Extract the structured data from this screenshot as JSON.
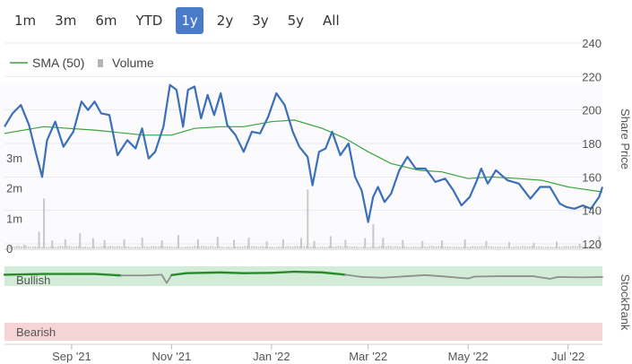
{
  "range_selector": {
    "buttons": [
      "1m",
      "3m",
      "6m",
      "YTD",
      "1y",
      "2y",
      "3y",
      "5y",
      "All"
    ],
    "active": "1y"
  },
  "legend": {
    "sma_label": "SMA (50)",
    "volume_label": "Volume"
  },
  "axes": {
    "price_title": "Share Price",
    "rank_title": "StockRank",
    "price_ticks": [
      "240",
      "220",
      "200",
      "180",
      "160",
      "140",
      "120"
    ],
    "volume_ticks": [
      "3m",
      "2m",
      "1m",
      "0"
    ],
    "date_ticks": [
      "Sep '21",
      "Nov '21",
      "Jan '22",
      "Mar '22",
      "May '22",
      "Jul '22"
    ]
  },
  "rank_bands": {
    "top": "Bullish",
    "bottom": "Bearish"
  },
  "colors": {
    "price": "#3b6fba",
    "sma": "#3aa33a",
    "volume": "#c8c8c8",
    "rank_bull": "#2a8a2a",
    "rank_neutral": "#8f8f8f",
    "bull_band": "#d3ecd8",
    "bear_band": "#f6d3d5"
  },
  "chart_data": {
    "type": "line",
    "x_range": [
      "2021-07-22",
      "2022-07-22"
    ],
    "ylim": [
      120,
      240
    ],
    "series": [
      {
        "name": "Share Price",
        "points": [
          [
            "2021-07-22",
            190
          ],
          [
            "2021-07-27",
            198
          ],
          [
            "2021-08-01",
            203
          ],
          [
            "2021-08-06",
            191
          ],
          [
            "2021-08-10",
            175
          ],
          [
            "2021-08-14",
            160
          ],
          [
            "2021-08-17",
            182
          ],
          [
            "2021-08-22",
            193
          ],
          [
            "2021-08-27",
            178
          ],
          [
            "2021-09-02",
            187
          ],
          [
            "2021-09-07",
            205
          ],
          [
            "2021-09-11",
            200
          ],
          [
            "2021-09-15",
            205
          ],
          [
            "2021-09-19",
            198
          ],
          [
            "2021-09-24",
            197
          ],
          [
            "2021-09-29",
            173
          ],
          [
            "2021-10-05",
            182
          ],
          [
            "2021-10-10",
            177
          ],
          [
            "2021-10-14",
            189
          ],
          [
            "2021-10-18",
            171
          ],
          [
            "2021-10-22",
            175
          ],
          [
            "2021-10-27",
            190
          ],
          [
            "2021-10-31",
            215
          ],
          [
            "2021-11-04",
            212
          ],
          [
            "2021-11-08",
            190
          ],
          [
            "2021-11-11",
            212
          ],
          [
            "2021-11-15",
            214
          ],
          [
            "2021-11-19",
            195
          ],
          [
            "2021-11-23",
            209
          ],
          [
            "2021-11-27",
            197
          ],
          [
            "2021-12-01",
            210
          ],
          [
            "2021-12-05",
            191
          ],
          [
            "2021-12-10",
            185
          ],
          [
            "2021-12-15",
            175
          ],
          [
            "2021-12-20",
            187
          ],
          [
            "2021-12-25",
            186
          ],
          [
            "2021-12-30",
            196
          ],
          [
            "2022-01-04",
            210
          ],
          [
            "2022-01-09",
            203
          ],
          [
            "2022-01-14",
            187
          ],
          [
            "2022-01-18",
            178
          ],
          [
            "2022-01-23",
            172
          ],
          [
            "2022-01-26",
            155
          ],
          [
            "2022-01-30",
            175
          ],
          [
            "2022-02-03",
            177
          ],
          [
            "2022-02-07",
            187
          ],
          [
            "2022-02-12",
            173
          ],
          [
            "2022-02-17",
            180
          ],
          [
            "2022-02-21",
            160
          ],
          [
            "2022-02-25",
            152
          ],
          [
            "2022-03-01",
            133
          ],
          [
            "2022-03-04",
            148
          ],
          [
            "2022-03-07",
            154
          ],
          [
            "2022-03-11",
            145
          ],
          [
            "2022-03-15",
            150
          ],
          [
            "2022-03-20",
            164
          ],
          [
            "2022-03-25",
            172
          ],
          [
            "2022-03-30",
            165
          ],
          [
            "2022-04-05",
            165
          ],
          [
            "2022-04-11",
            157
          ],
          [
            "2022-04-17",
            159
          ],
          [
            "2022-04-22",
            152
          ],
          [
            "2022-04-27",
            143
          ],
          [
            "2022-05-02",
            148
          ],
          [
            "2022-05-06",
            157
          ],
          [
            "2022-05-09",
            165
          ],
          [
            "2022-05-13",
            156
          ],
          [
            "2022-05-18",
            164
          ],
          [
            "2022-05-25",
            158
          ],
          [
            "2022-06-01",
            156
          ],
          [
            "2022-06-08",
            147
          ],
          [
            "2022-06-14",
            154
          ],
          [
            "2022-06-20",
            154
          ],
          [
            "2022-06-26",
            144
          ],
          [
            "2022-06-30",
            142
          ],
          [
            "2022-07-05",
            141
          ],
          [
            "2022-07-10",
            143
          ],
          [
            "2022-07-15",
            141
          ],
          [
            "2022-07-20",
            148
          ],
          [
            "2022-07-22",
            154
          ]
        ]
      },
      {
        "name": "SMA (50)",
        "points": [
          [
            "2021-07-22",
            186
          ],
          [
            "2021-08-15",
            190
          ],
          [
            "2021-09-15",
            188
          ],
          [
            "2021-10-15",
            185
          ],
          [
            "2021-11-01",
            185
          ],
          [
            "2021-11-15",
            189
          ],
          [
            "2021-12-01",
            190
          ],
          [
            "2021-12-15",
            190
          ],
          [
            "2022-01-01",
            193
          ],
          [
            "2022-01-15",
            194
          ],
          [
            "2022-02-01",
            189
          ],
          [
            "2022-02-15",
            183
          ],
          [
            "2022-03-01",
            175
          ],
          [
            "2022-03-15",
            168
          ],
          [
            "2022-04-01",
            164
          ],
          [
            "2022-04-15",
            163
          ],
          [
            "2022-05-01",
            159
          ],
          [
            "2022-05-15",
            160
          ],
          [
            "2022-06-01",
            159
          ],
          [
            "2022-06-15",
            158
          ],
          [
            "2022-07-01",
            154
          ],
          [
            "2022-07-22",
            151
          ]
        ]
      }
    ],
    "volume": {
      "ylim": [
        0,
        3000000
      ],
      "points": [
        [
          "2021-08-03",
          120000
        ],
        [
          "2021-08-12",
          550000
        ],
        [
          "2021-08-15",
          1650000
        ],
        [
          "2021-08-20",
          260000
        ],
        [
          "2021-08-28",
          300000
        ],
        [
          "2021-09-06",
          500000
        ],
        [
          "2021-09-14",
          340000
        ],
        [
          "2021-09-21",
          280000
        ],
        [
          "2021-10-03",
          300000
        ],
        [
          "2021-10-14",
          350000
        ],
        [
          "2021-10-26",
          260000
        ],
        [
          "2021-11-05",
          440000
        ],
        [
          "2021-11-17",
          300000
        ],
        [
          "2021-11-29",
          380000
        ],
        [
          "2021-12-09",
          280000
        ],
        [
          "2021-12-18",
          360000
        ],
        [
          "2021-12-29",
          230000
        ],
        [
          "2022-01-08",
          300000
        ],
        [
          "2022-01-19",
          340000
        ],
        [
          "2022-01-23",
          1950000
        ],
        [
          "2022-01-27",
          250000
        ],
        [
          "2022-02-06",
          400000
        ],
        [
          "2022-02-15",
          280000
        ],
        [
          "2022-02-27",
          340000
        ],
        [
          "2022-03-04",
          800000
        ],
        [
          "2022-03-10",
          350000
        ],
        [
          "2022-03-22",
          280000
        ],
        [
          "2022-04-03",
          240000
        ],
        [
          "2022-04-15",
          260000
        ],
        [
          "2022-04-29",
          300000
        ],
        [
          "2022-05-12",
          240000
        ],
        [
          "2022-05-26",
          200000
        ],
        [
          "2022-06-10",
          180000
        ],
        [
          "2022-06-24",
          220000
        ],
        [
          "2022-07-08",
          150000
        ],
        [
          "2022-07-20",
          400000
        ]
      ]
    },
    "stockrank": {
      "ylim": [
        0,
        100
      ],
      "points": [
        [
          "2021-07-22",
          80
        ],
        [
          "2021-08-05",
          81
        ],
        [
          "2021-08-15",
          82
        ],
        [
          "2021-09-01",
          82
        ],
        [
          "2021-09-15",
          82
        ],
        [
          "2021-10-01",
          78
        ],
        [
          "2021-10-15",
          78
        ],
        [
          "2021-10-26",
          80
        ],
        [
          "2021-10-29",
          58
        ],
        [
          "2021-11-01",
          79
        ],
        [
          "2021-11-10",
          84
        ],
        [
          "2021-12-01",
          86
        ],
        [
          "2021-12-15",
          84
        ],
        [
          "2022-01-01",
          85
        ],
        [
          "2022-01-15",
          88
        ],
        [
          "2022-02-01",
          86
        ],
        [
          "2022-02-15",
          80
        ],
        [
          "2022-02-25",
          74
        ],
        [
          "2022-03-10",
          72
        ],
        [
          "2022-03-25",
          76
        ],
        [
          "2022-04-05",
          79
        ],
        [
          "2022-04-20",
          74
        ],
        [
          "2022-05-01",
          70
        ],
        [
          "2022-05-05",
          75
        ],
        [
          "2022-05-20",
          76
        ],
        [
          "2022-06-10",
          76
        ],
        [
          "2022-06-20",
          69
        ],
        [
          "2022-06-25",
          74
        ],
        [
          "2022-07-10",
          73
        ],
        [
          "2022-07-22",
          74
        ]
      ]
    }
  }
}
